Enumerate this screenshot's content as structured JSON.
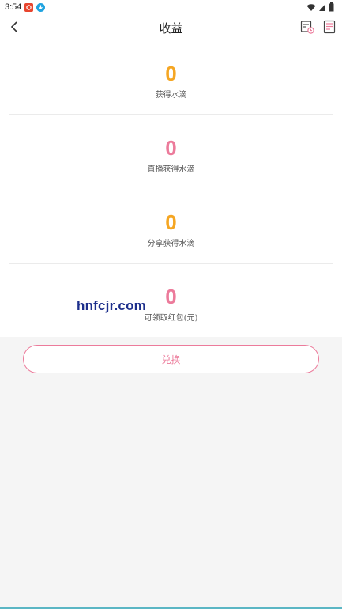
{
  "status_bar": {
    "time": "3:54"
  },
  "header": {
    "title": "收益"
  },
  "stats": [
    {
      "value": "0",
      "label": "获得水滴",
      "color": "#f5a623"
    },
    {
      "value": "0",
      "label": "直播获得水滴",
      "color": "#ec7b9b"
    },
    {
      "value": "0",
      "label": "分享获得水滴",
      "color": "#f5a623"
    },
    {
      "value": "0",
      "label": "可领取红包(元)",
      "color": "#ec7b9b"
    }
  ],
  "watermark": "hnfcjr.com",
  "exchange_button": {
    "label": "兑换"
  },
  "colors": {
    "orange": "#f5a623",
    "pink": "#ec7b9b",
    "background": "#f5f5f5"
  }
}
